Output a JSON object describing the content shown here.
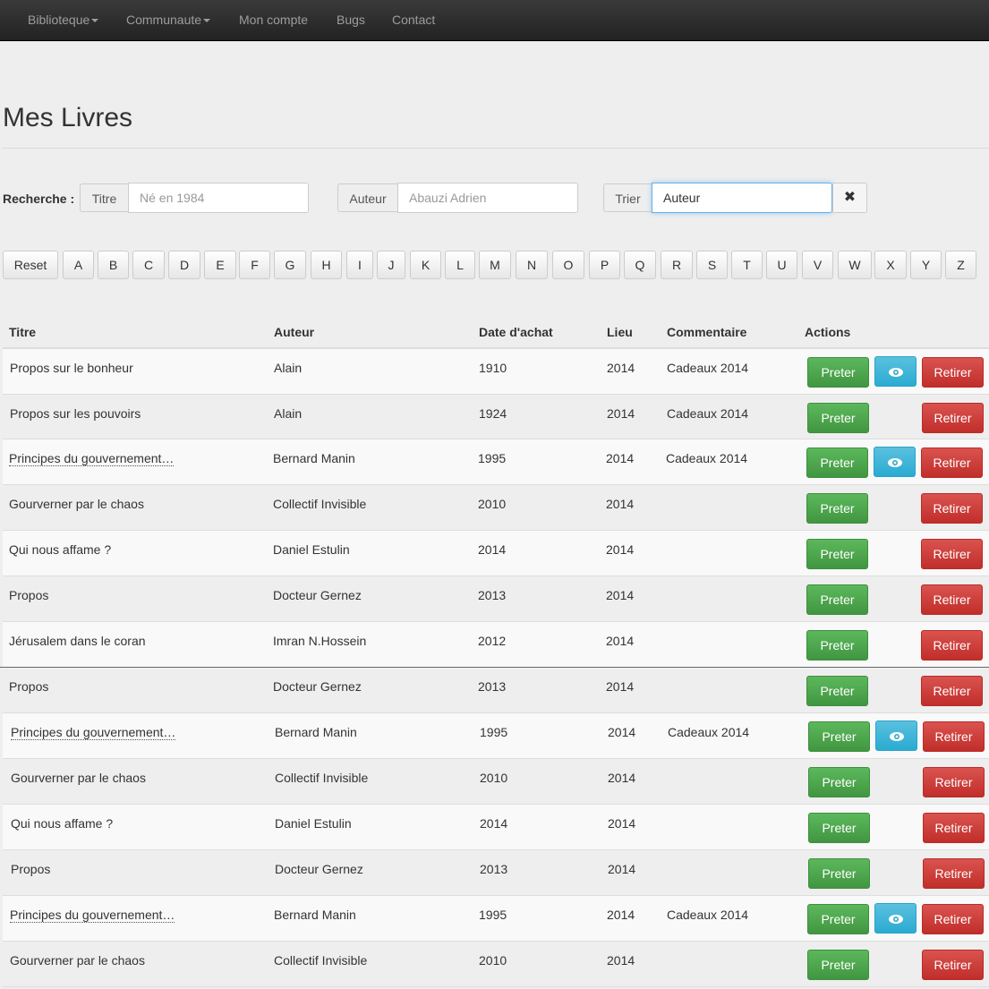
{
  "navbar": {
    "items": [
      {
        "label": "Biblioteque",
        "dropdown": true
      },
      {
        "label": "Communaute",
        "dropdown": true
      },
      {
        "label": "Mon compte",
        "dropdown": false
      },
      {
        "label": "Bugs",
        "dropdown": false
      },
      {
        "label": "Contact",
        "dropdown": false
      }
    ]
  },
  "page": {
    "title": "Mes Livres"
  },
  "search": {
    "label": "Recherche :",
    "titre": {
      "addon": "Titre",
      "placeholder": "Né en 1984",
      "value": ""
    },
    "auteur": {
      "addon": "Auteur",
      "placeholder": "Abauzi Adrien",
      "value": ""
    },
    "trier": {
      "addon": "Trier",
      "value": "Auteur"
    },
    "clear_icon": "close-icon"
  },
  "letters": [
    "Reset",
    "A",
    "B",
    "C",
    "D",
    "E",
    "F",
    "G",
    "H",
    "I",
    "J",
    "K",
    "L",
    "M",
    "N",
    "O",
    "P",
    "Q",
    "R",
    "S",
    "T",
    "U",
    "V",
    "W",
    "X",
    "Y",
    "Z"
  ],
  "table": {
    "columns": [
      "Titre",
      "Auteur",
      "Date d'achat",
      "Lieu",
      "Commentaire",
      "Actions"
    ],
    "actions": {
      "lend": "Preter",
      "view_icon": "eye-icon",
      "remove": "Retirer"
    },
    "rows": [
      {
        "titre": "Propos sur le bonheur",
        "auteur": "Alain",
        "date": "1910",
        "lieu": "2014",
        "commentaire": "Cadeaux 2014",
        "view": true,
        "abbr": false
      },
      {
        "titre": "Propos sur les pouvoirs",
        "auteur": "Alain",
        "date": "1924",
        "lieu": "2014",
        "commentaire": "Cadeaux 2014",
        "view": false,
        "abbr": false
      },
      {
        "titre": "Principes du gouvernement…",
        "auteur": "Bernard Manin",
        "date": "1995",
        "lieu": "2014",
        "commentaire": "Cadeaux 2014",
        "view": true,
        "abbr": true
      },
      {
        "titre": "Gourverner par le chaos",
        "auteur": "Collectif Invisible",
        "date": "2010",
        "lieu": "2014",
        "commentaire": "",
        "view": false,
        "abbr": false
      },
      {
        "titre": "Qui nous affame ?",
        "auteur": "Daniel Estulin",
        "date": "2014",
        "lieu": "2014",
        "commentaire": "",
        "view": false,
        "abbr": false
      },
      {
        "titre": "Propos",
        "auteur": "Docteur Gernez",
        "date": "2013",
        "lieu": "2014",
        "commentaire": "",
        "view": false,
        "abbr": false
      },
      {
        "titre": "Jérusalem dans le coran",
        "auteur": "Imran N.Hossein",
        "date": "2012",
        "lieu": "2014",
        "commentaire": "",
        "view": false,
        "abbr": false
      },
      {
        "titre": "Propos",
        "auteur": "Docteur Gernez",
        "date": "2013",
        "lieu": "2014",
        "commentaire": "",
        "view": false,
        "abbr": false
      },
      {
        "titre": "Principes du gouvernement…",
        "auteur": "Bernard Manin",
        "date": "1995",
        "lieu": "2014",
        "commentaire": "Cadeaux 2014",
        "view": true,
        "abbr": true
      },
      {
        "titre": "Gourverner par le chaos",
        "auteur": "Collectif Invisible",
        "date": "2010",
        "lieu": "2014",
        "commentaire": "",
        "view": false,
        "abbr": false
      },
      {
        "titre": "Qui nous affame ?",
        "auteur": "Daniel Estulin",
        "date": "2014",
        "lieu": "2014",
        "commentaire": "",
        "view": false,
        "abbr": false
      },
      {
        "titre": "Propos",
        "auteur": "Docteur Gernez",
        "date": "2013",
        "lieu": "2014",
        "commentaire": "",
        "view": false,
        "abbr": false
      },
      {
        "titre": "Principes du gouvernement…",
        "auteur": "Bernard Manin",
        "date": "1995",
        "lieu": "2014",
        "commentaire": "Cadeaux 2014",
        "view": true,
        "abbr": true
      },
      {
        "titre": "Gourverner par le chaos",
        "auteur": "Collectif Invisible",
        "date": "2010",
        "lieu": "2014",
        "commentaire": "",
        "view": false,
        "abbr": false
      }
    ]
  },
  "colors": {
    "success": "#5cb85c",
    "danger": "#d9534f",
    "info": "#5bc0de",
    "navbar": "#222222"
  }
}
